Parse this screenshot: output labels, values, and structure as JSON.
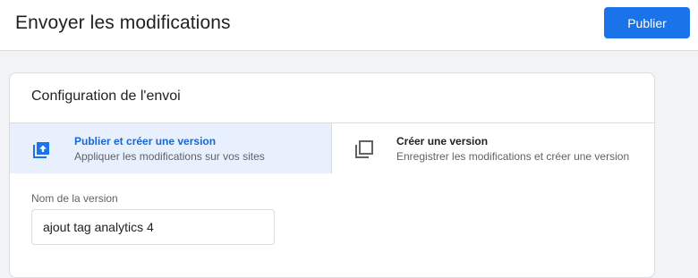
{
  "header": {
    "title": "Envoyer les modifications",
    "publish_label": "Publier"
  },
  "config": {
    "title": "Configuration de l'envoi",
    "options": [
      {
        "title": "Publier et créer une version",
        "subtitle": "Appliquer les modifications sur vos sites",
        "icon": "publish-upload-icon",
        "selected": true
      },
      {
        "title": "Créer une version",
        "subtitle": "Enregistrer les modifications et créer une version",
        "icon": "copy-version-icon",
        "selected": false
      }
    ],
    "version_name": {
      "label": "Nom de la version",
      "value": "ajout tag analytics 4"
    }
  },
  "colors": {
    "accent": "#1a73e8",
    "selected_bg": "#e8f0fe",
    "selected_text": "#1967d2"
  }
}
